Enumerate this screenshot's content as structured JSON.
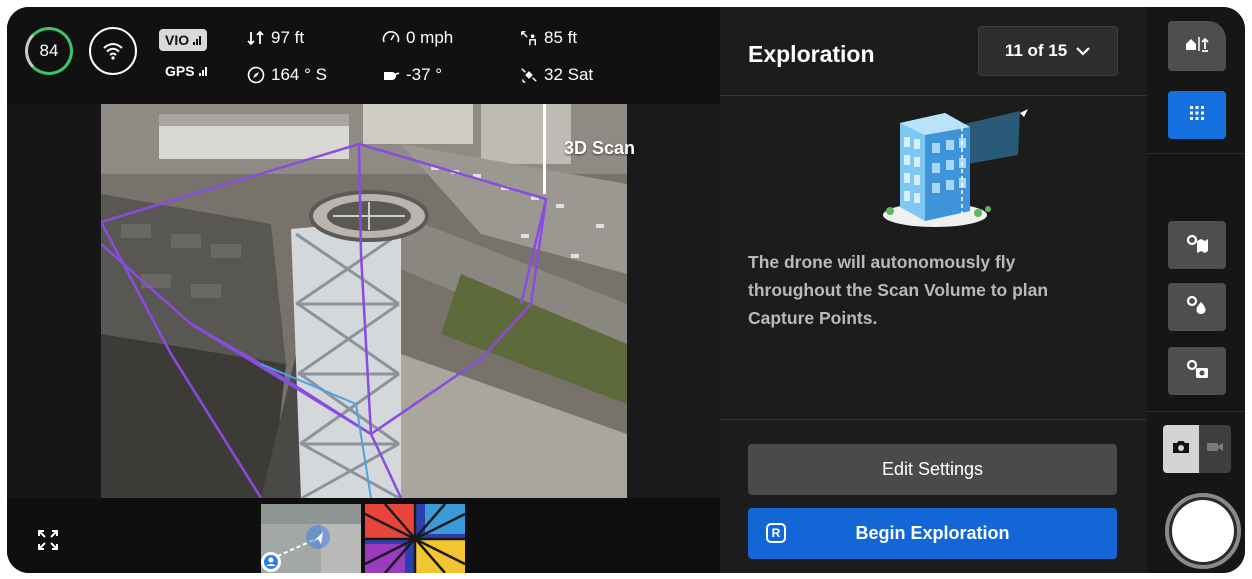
{
  "telemetry": {
    "battery": "84",
    "vio_label": "VIO",
    "gps_label": "GPS",
    "altitude": "97 ft",
    "heading": "164 ° S",
    "speed": "0 mph",
    "gimbal_pitch": "-37 °",
    "distance": "85 ft",
    "satellites": "32 Sat"
  },
  "feed": {
    "scan_label": "3D Scan"
  },
  "panel": {
    "title": "Exploration",
    "counter": "11 of 15",
    "description": "The drone will autonomously fly throughout the Scan Volume to plan Capture Points.",
    "edit_button": "Edit Settings",
    "begin_button": "Begin Exploration",
    "begin_key": "R"
  },
  "colors": {
    "accent_blue": "#1366d6",
    "battery_green": "#3ac46b",
    "scan_purple": "#8a4be0"
  },
  "icons": {
    "battery": "battery-ring-icon",
    "wifi": "wifi-icon",
    "altitude": "altitude-arrows-icon",
    "heading": "compass-icon",
    "speed": "speedometer-icon",
    "gimbal": "gimbal-icon",
    "distance": "home-distance-icon",
    "satellites": "satellite-icon",
    "expand": "expand-icon",
    "home": "home-return-icon",
    "grid": "grid-icon",
    "camera": "camera-icon",
    "video": "video-icon"
  }
}
